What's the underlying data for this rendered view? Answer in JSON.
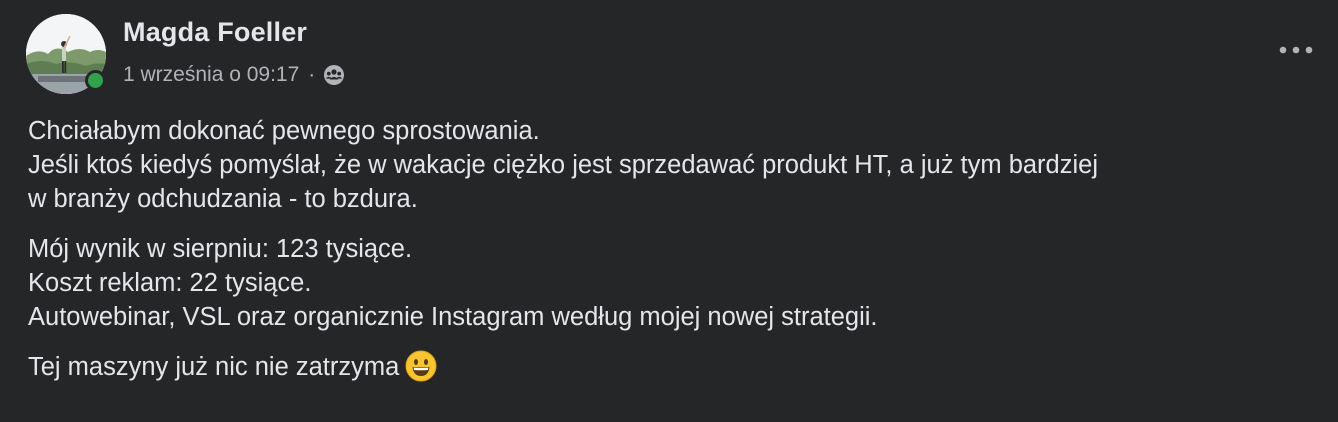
{
  "post": {
    "author": "Magda Foeller",
    "timestamp": "1 września o 09:17",
    "separator": "·",
    "audience_icon": "friends-icon",
    "online": true,
    "more_icon": "more-horizontal-icon",
    "paragraphs": [
      {
        "lines": [
          "Chciałabym dokonać pewnego sprostowania.",
          "Jeśli ktoś kiedyś pomyślał, że w wakacje ciężko jest sprzedawać produkt HT, a już tym bardziej",
          "w branży odchudzania - to bzdura."
        ]
      },
      {
        "lines": [
          "Mój wynik w sierpniu: 123 tysiące.",
          "Koszt reklam: 22 tysiące.",
          "Autowebinar, VSL oraz organicznie Instagram według mojej nowej strategii."
        ]
      },
      {
        "lines": [
          "Tej maszyny już nic nie zatrzyma"
        ],
        "emoji": "grinning-face-emoji"
      }
    ]
  },
  "colors": {
    "background": "#252628",
    "primary_text": "#e4e6eb",
    "secondary_text": "#b0b3b8",
    "online_green": "#31a24c"
  }
}
